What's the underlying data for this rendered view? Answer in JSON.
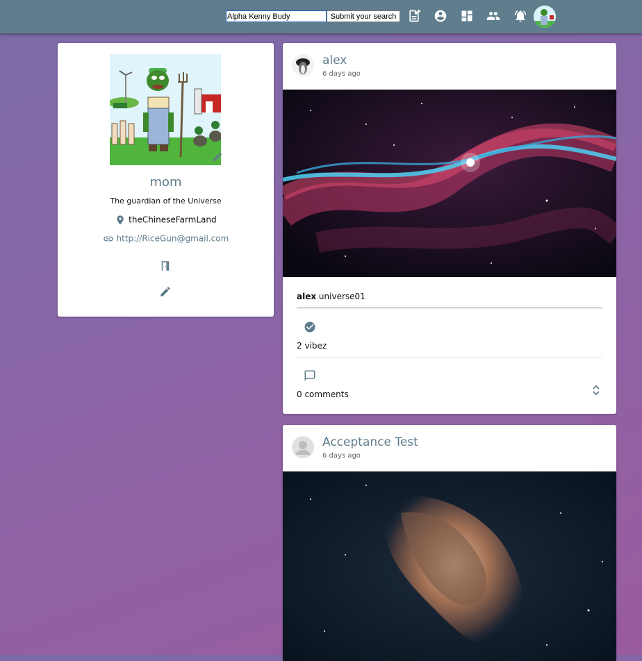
{
  "topbar": {
    "search_value": "Alpha Kenny Budy",
    "search_button_label": "Submit your search"
  },
  "profile": {
    "name": "mom",
    "bio": "The guardian of the Universe",
    "location": "theChineseFarmLand",
    "website": "http://RiceGun@gmail.com"
  },
  "posts": [
    {
      "author": "alex",
      "time": "6 days ago",
      "caption_author": "alex",
      "caption_text": "universe01",
      "vibes": "2 vibez",
      "comments": "0 comments"
    },
    {
      "author": "Acceptance Test",
      "time": "6 days ago"
    }
  ],
  "icons": {
    "nav": [
      "new-post-icon",
      "account-circle-icon",
      "dashboard-icon",
      "people-icon",
      "notifications-icon"
    ],
    "accent": "#5f7d8c"
  }
}
